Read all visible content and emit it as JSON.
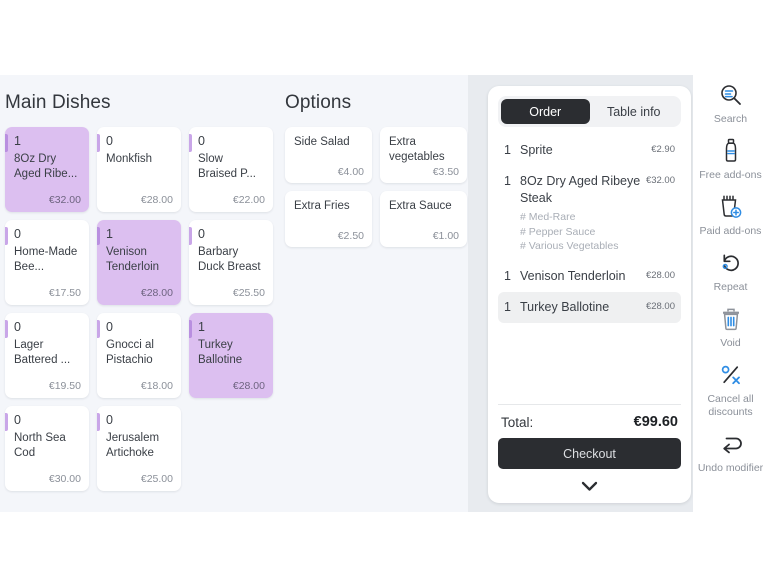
{
  "menu": {
    "dishes_title": "Main Dishes",
    "options_title": "Options",
    "dishes": [
      {
        "qty": "1",
        "name": "8Oz Dry Aged Ribe...",
        "price": "€32.00",
        "selected": true
      },
      {
        "qty": "0",
        "name": "Monkfish",
        "price": "€28.00",
        "selected": false
      },
      {
        "qty": "0",
        "name": "Slow Braised P...",
        "price": "€22.00",
        "selected": false
      },
      {
        "qty": "0",
        "name": "Home-Made Bee...",
        "price": "€17.50",
        "selected": false
      },
      {
        "qty": "1",
        "name": "Venison Tenderloin",
        "price": "€28.00",
        "selected": true
      },
      {
        "qty": "0",
        "name": "Barbary Duck Breast",
        "price": "€25.50",
        "selected": false
      },
      {
        "qty": "0",
        "name": "Lager Battered ...",
        "price": "€19.50",
        "selected": false
      },
      {
        "qty": "0",
        "name": "Gnocci al Pistachio",
        "price": "€18.00",
        "selected": false
      },
      {
        "qty": "1",
        "name": "Turkey Ballotine",
        "price": "€28.00",
        "selected": true
      },
      {
        "qty": "0",
        "name": "North Sea Cod",
        "price": "€30.00",
        "selected": false
      },
      {
        "qty": "0",
        "name": "Jerusalem Artichoke",
        "price": "€25.00",
        "selected": false
      }
    ],
    "options": [
      {
        "name": "Side Salad",
        "price": "€4.00"
      },
      {
        "name": "Extra vegetables",
        "price": "€3.50"
      },
      {
        "name": "Extra Fries",
        "price": "€2.50"
      },
      {
        "name": "Extra Sauce",
        "price": "€1.00"
      }
    ]
  },
  "order": {
    "tabs": [
      {
        "label": "Order",
        "active": true
      },
      {
        "label": "Table info",
        "active": false
      }
    ],
    "items": [
      {
        "qty": "1",
        "name": "Sprite",
        "price": "€2.90",
        "mods": [],
        "active": false
      },
      {
        "qty": "1",
        "name": "8Oz Dry Aged Ribeye Steak",
        "price": "€32.00",
        "mods": [
          "# Med-Rare",
          "# Pepper Sauce",
          "# Various Vegetables"
        ],
        "active": false
      },
      {
        "qty": "1",
        "name": "Venison Tenderloin",
        "price": "€28.00",
        "mods": [],
        "active": false
      },
      {
        "qty": "1",
        "name": "Turkey Ballotine",
        "price": "€28.00",
        "mods": [],
        "active": true
      }
    ],
    "total_label": "Total:",
    "total_value": "€99.60",
    "checkout_label": "Checkout"
  },
  "sidebar": {
    "items": [
      {
        "label": "Search",
        "icon": "search-icon"
      },
      {
        "label": "Free add-ons",
        "icon": "sauce-bottle-icon"
      },
      {
        "label": "Paid add-ons",
        "icon": "cup-plus-icon"
      },
      {
        "label": "Repeat",
        "icon": "repeat-icon"
      },
      {
        "label": "Void",
        "icon": "trash-icon"
      },
      {
        "label": "Cancel all discounts",
        "icon": "percent-cancel-icon"
      },
      {
        "label": "Undo modifier",
        "icon": "undo-icon"
      }
    ]
  },
  "colors": {
    "selected_tile": "#dcbff0",
    "accent_bar": "#c9a6e8",
    "panel_bg": "#e8ebef",
    "menu_bg": "#f4f6fa",
    "dark": "#2b2d31",
    "icon_blue": "#2f8de4"
  }
}
